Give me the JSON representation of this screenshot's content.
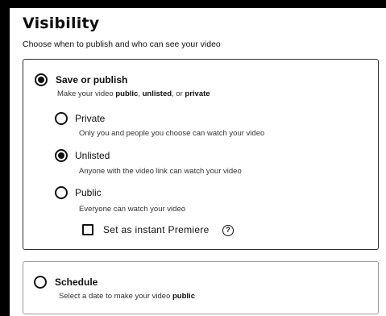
{
  "header": {
    "title": "Visibility",
    "subtitle": "Choose when to publish and who can see your video"
  },
  "save_or_publish": {
    "label": "Save or publish",
    "selected": true,
    "desc_prefix": "Make your video ",
    "desc_public": "public",
    "desc_sep1": ", ",
    "desc_unlisted": "unlisted",
    "desc_sep2": ", or ",
    "desc_private": "private",
    "options": [
      {
        "label": "Private",
        "description": "Only you and people you choose can watch your video",
        "selected": false
      },
      {
        "label": "Unlisted",
        "description": "Anyone with the video link can watch your video",
        "selected": true
      },
      {
        "label": "Public",
        "description": "Everyone can watch your video",
        "selected": false
      }
    ],
    "premiere_checkbox": {
      "label": "Set as instant Premiere",
      "checked": false,
      "help_icon": "?"
    }
  },
  "schedule": {
    "label": "Schedule",
    "selected": false,
    "desc_prefix": "Select a date to make your video ",
    "desc_public": "public"
  }
}
